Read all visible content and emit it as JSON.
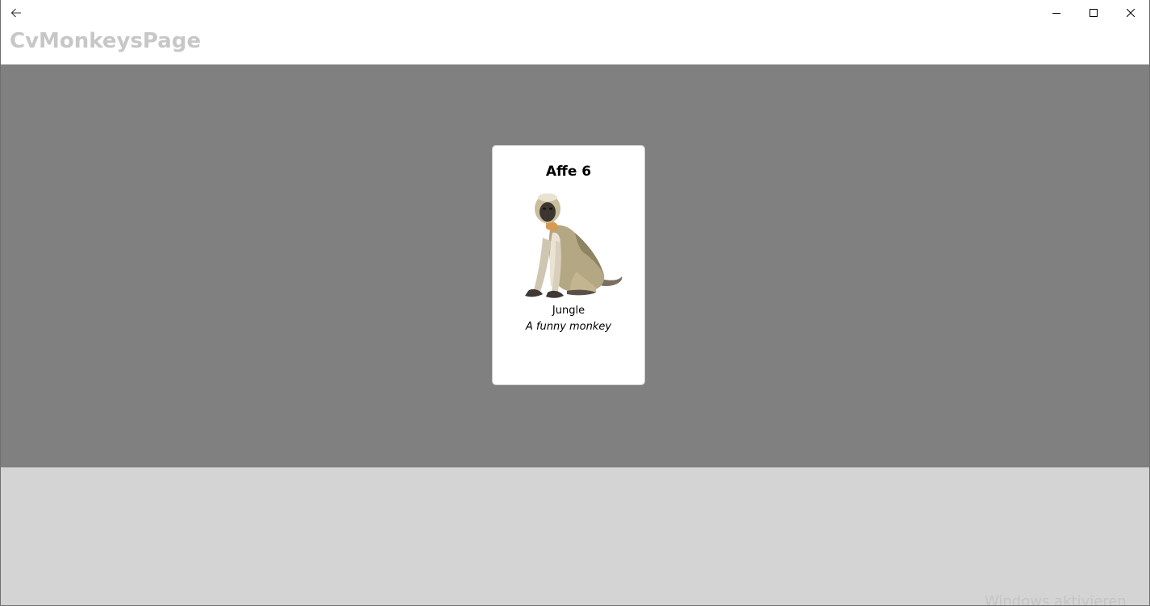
{
  "window": {
    "back_icon": "back-arrow-icon",
    "caption_buttons": [
      "minimize-icon",
      "maximize-icon",
      "close-icon"
    ]
  },
  "header": {
    "title": "CvMonkeysPage"
  },
  "carousel": {
    "items": [
      {
        "name": "Affe 6",
        "image": "monkey-photo",
        "location": "Jungle",
        "details": "A funny monkey"
      }
    ]
  },
  "watermark": {
    "text": "Windows aktivieren"
  },
  "colors": {
    "header_bg": "#ffffff",
    "title_color": "#c7c7c7",
    "carousel_bg": "#808080",
    "page_bg": "#d4d4d4",
    "card_bg": "#ffffff"
  }
}
